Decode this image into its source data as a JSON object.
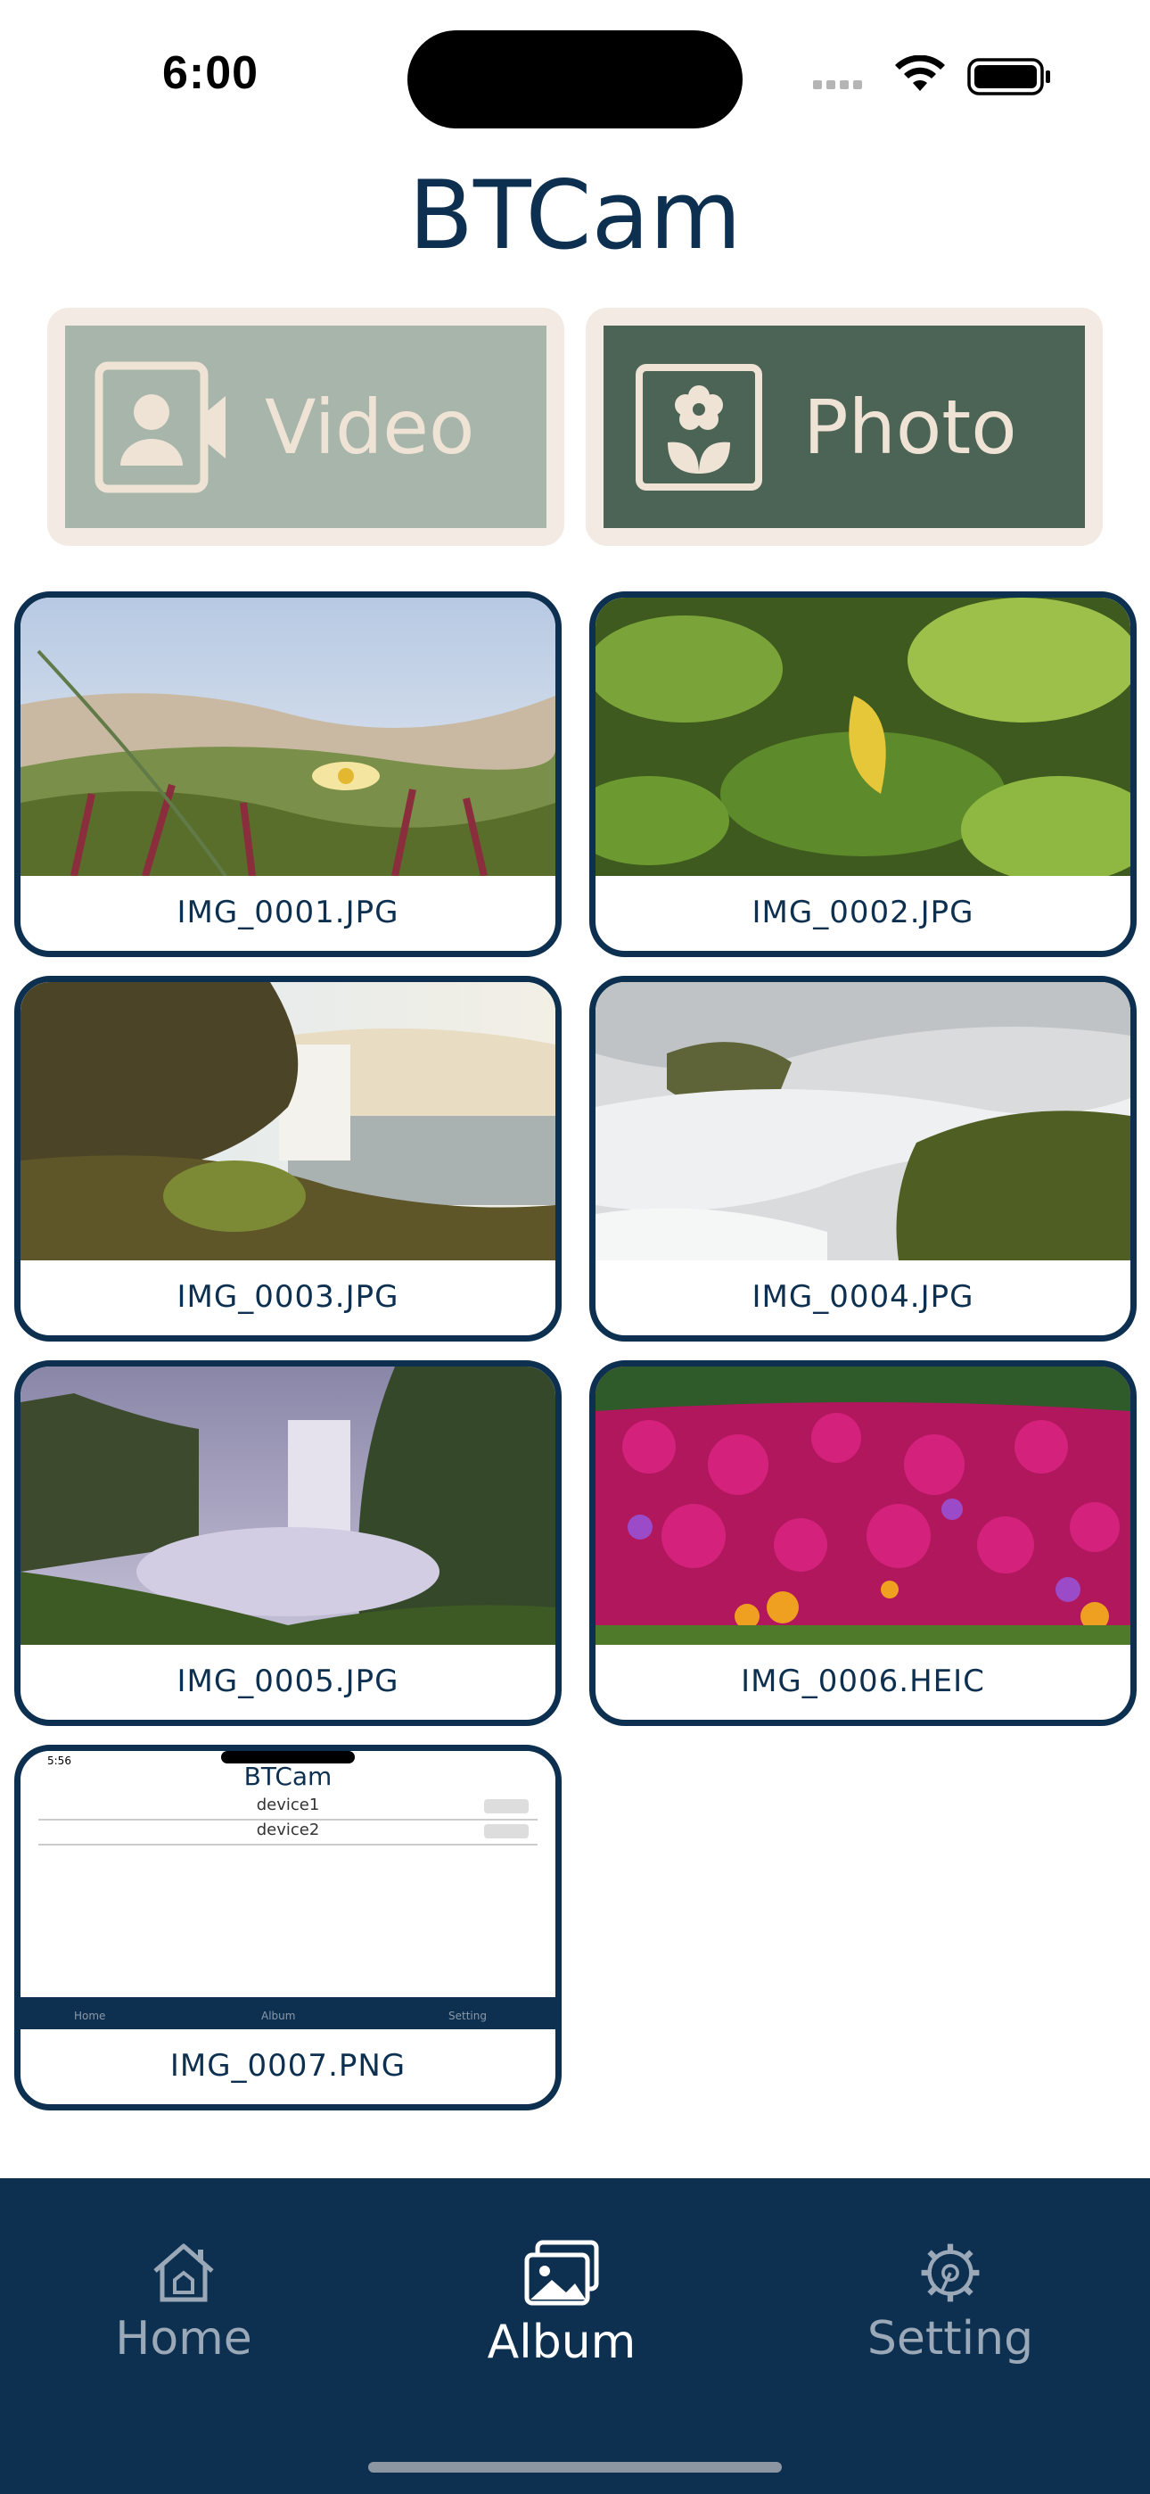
{
  "status_bar": {
    "time": "6:00"
  },
  "header": {
    "title": "BTCam"
  },
  "modes": {
    "video": {
      "label": "Video",
      "icon": "camera-icon"
    },
    "photo": {
      "label": "Photo",
      "icon": "flower-photo-icon"
    }
  },
  "album": {
    "items": [
      {
        "name": "IMG_0001.JPG"
      },
      {
        "name": "IMG_0002.JPG"
      },
      {
        "name": "IMG_0003.JPG"
      },
      {
        "name": "IMG_0004.JPG"
      },
      {
        "name": "IMG_0005.JPG"
      },
      {
        "name": "IMG_0006.HEIC"
      },
      {
        "name": "IMG_0007.PNG"
      }
    ],
    "screenshot_thumb": {
      "time": "5:56",
      "title": "BTCam",
      "devices": [
        "device1",
        "device2"
      ],
      "tabs": [
        "Home",
        "Album",
        "Setting"
      ]
    }
  },
  "tabbar": {
    "items": [
      {
        "label": "Home",
        "icon": "home-icon"
      },
      {
        "label": "Album",
        "icon": "photos-icon"
      },
      {
        "label": "Setting",
        "icon": "gear-icon"
      }
    ],
    "active": "Album"
  },
  "colors": {
    "primary": "#0d3050",
    "video_bg": "#a7b5ab",
    "photo_bg": "#4b6455",
    "mode_frame": "#f3ebe3"
  }
}
